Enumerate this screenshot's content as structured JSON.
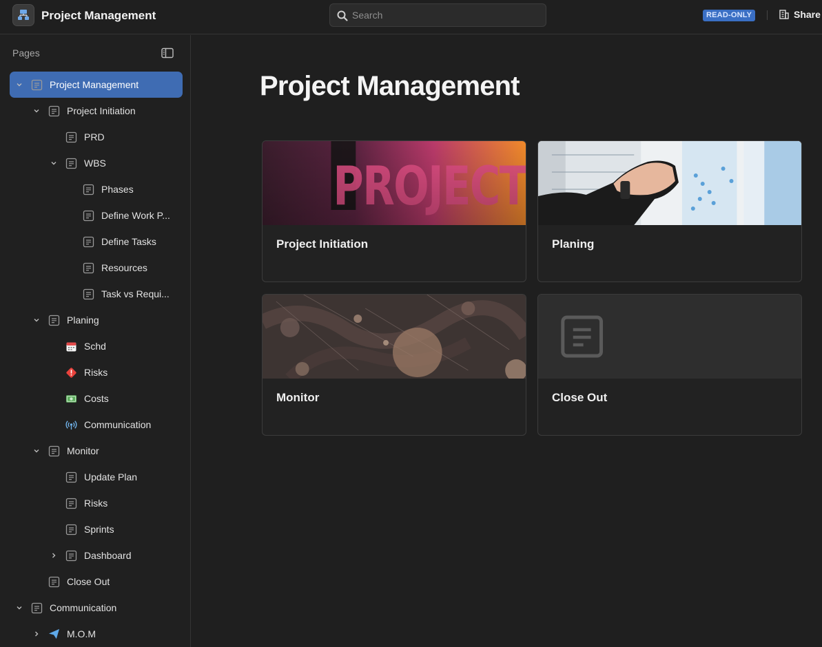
{
  "header": {
    "app_title": "Project Management",
    "search_placeholder": "Search",
    "badge": "READ-ONLY",
    "share_label": "Share"
  },
  "sidebar": {
    "section_label": "Pages",
    "items": [
      {
        "label": "Project Management",
        "chevron": "down",
        "icon": "page-icon",
        "active": true
      },
      {
        "label": "Project Initiation",
        "chevron": "down",
        "icon": "page-icon"
      },
      {
        "label": "PRD",
        "chevron": "none",
        "icon": "page-icon"
      },
      {
        "label": "WBS",
        "chevron": "down",
        "icon": "page-icon"
      },
      {
        "label": "Phases",
        "chevron": "none",
        "icon": "page-icon"
      },
      {
        "label": "Define Work P...",
        "chevron": "none",
        "icon": "page-icon"
      },
      {
        "label": "Define Tasks",
        "chevron": "none",
        "icon": "page-icon"
      },
      {
        "label": "Resources",
        "chevron": "none",
        "icon": "page-icon"
      },
      {
        "label": "Task vs Requi...",
        "chevron": "none",
        "icon": "page-icon"
      },
      {
        "label": "Planing",
        "chevron": "down",
        "icon": "page-icon"
      },
      {
        "label": "Schd",
        "chevron": "none",
        "icon": "calendar-icon"
      },
      {
        "label": "Risks",
        "chevron": "none",
        "icon": "warning-diamond-icon"
      },
      {
        "label": "Costs",
        "chevron": "none",
        "icon": "money-icon"
      },
      {
        "label": "Communication",
        "chevron": "none",
        "icon": "broadcast-icon"
      },
      {
        "label": "Monitor",
        "chevron": "down",
        "icon": "page-icon"
      },
      {
        "label": "Update Plan",
        "chevron": "none",
        "icon": "page-icon"
      },
      {
        "label": "Risks",
        "chevron": "none",
        "icon": "page-icon"
      },
      {
        "label": "Sprints",
        "chevron": "none",
        "icon": "page-icon"
      },
      {
        "label": "Dashboard",
        "chevron": "right",
        "icon": "page-icon"
      },
      {
        "label": "Close Out",
        "chevron": "none",
        "icon": "page-icon"
      },
      {
        "label": "Communication",
        "chevron": "down",
        "icon": "page-icon"
      },
      {
        "label": "M.O.M",
        "chevron": "right",
        "icon": "paper-plane-icon"
      }
    ]
  },
  "main": {
    "title": "Project Management",
    "cards": [
      {
        "title": "Project Initiation",
        "cover": "projects-sign-photo"
      },
      {
        "title": "Planing",
        "cover": "planning-board-photo"
      },
      {
        "title": "Monitor",
        "cover": "bokeh-network-photo"
      },
      {
        "title": "Close Out",
        "cover": "page-icon-placeholder"
      }
    ]
  },
  "colors": {
    "background": "#1f1f1f",
    "active_item": "#3f6cb3",
    "badge": "#3a6fc4",
    "border": "#353535"
  }
}
